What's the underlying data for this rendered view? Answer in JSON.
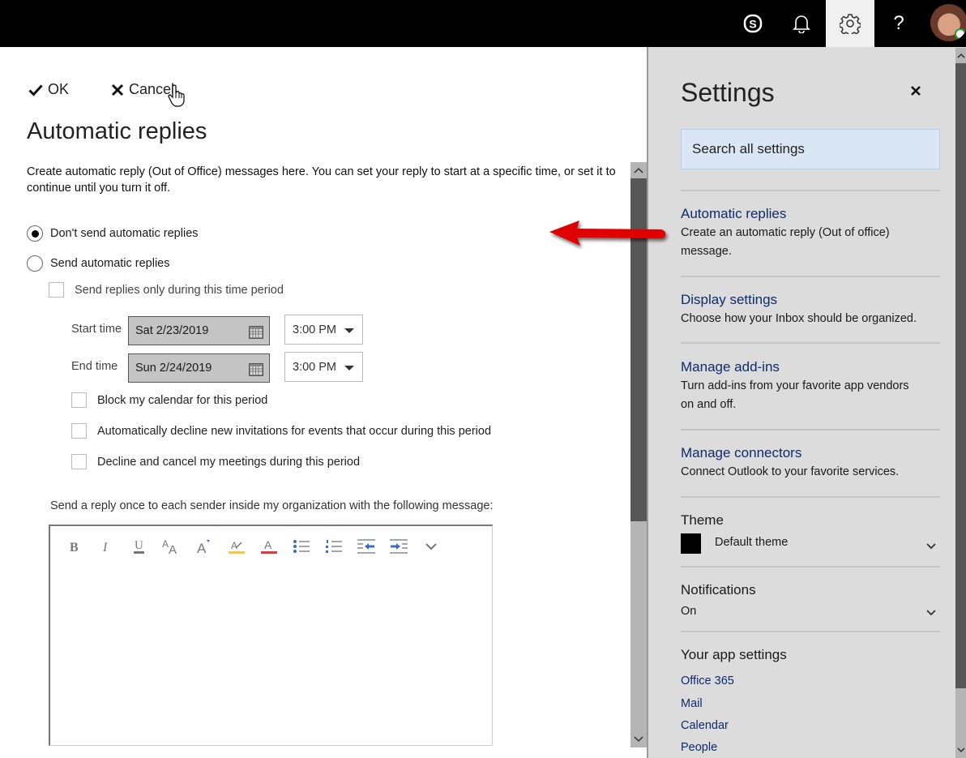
{
  "topbar": {
    "icons": [
      "skype-icon",
      "bell-icon",
      "gear-icon",
      "help-icon",
      "avatar"
    ],
    "help_glyph": "?",
    "active": "gear-icon"
  },
  "main": {
    "ok_label": "OK",
    "cancel_label": "Cancel",
    "title": "Automatic replies",
    "description": "Create automatic reply (Out of Office) messages here. You can set your reply to start at a specific time, or set it to continue until you turn it off.",
    "options": [
      {
        "label": "Don't send automatic replies",
        "selected": true
      },
      {
        "label": "Send automatic replies",
        "selected": false
      }
    ],
    "time_period_checkbox": {
      "label": "Send replies only during this time period",
      "checked": false
    },
    "start": {
      "label": "Start time",
      "date": "Sat 2/23/2019",
      "time": "3:00 PM"
    },
    "end": {
      "label": "End time",
      "date": "Sun 2/24/2019",
      "time": "3:00 PM"
    },
    "period_options": [
      {
        "label": "Block my calendar for this period",
        "checked": false
      },
      {
        "label": "Automatically decline new invitations for events that occur during this period",
        "checked": false
      },
      {
        "label": "Decline and cancel my meetings during this period",
        "checked": false
      }
    ],
    "message_label": "Send a reply once to each sender inside my organization with the following message:",
    "editor_toolbar": [
      "bold",
      "italic",
      "underline",
      "font-size",
      "grow-font",
      "highlight",
      "font-color",
      "bullets",
      "numbering",
      "decrease-indent",
      "increase-indent",
      "more"
    ],
    "editor_content": "",
    "scroll_position": 0.0
  },
  "settings": {
    "title": "Settings",
    "search_placeholder": "Search all settings",
    "items": [
      {
        "title": "Automatic replies",
        "description": "Create an automatic reply (Out of office) message."
      },
      {
        "title": "Display settings",
        "description": "Choose how your Inbox should be organized."
      },
      {
        "title": "Manage add-ins",
        "description": "Turn add-ins from your favorite app vendors on and off."
      },
      {
        "title": "Manage connectors",
        "description": "Connect Outlook to your favorite services."
      }
    ],
    "theme": {
      "heading": "Theme",
      "value": "Default theme",
      "swatch_color": "#000000"
    },
    "notifications": {
      "heading": "Notifications",
      "value": "On"
    },
    "app_settings": {
      "heading": "Your app settings",
      "links": [
        "Office 365",
        "Mail",
        "Calendar",
        "People"
      ]
    }
  },
  "colors": {
    "link": "#0f2b6b",
    "annotation_arrow": "#e00000",
    "highlight_bar": "#f5c842",
    "font_color_bar": "#e03c3c"
  }
}
